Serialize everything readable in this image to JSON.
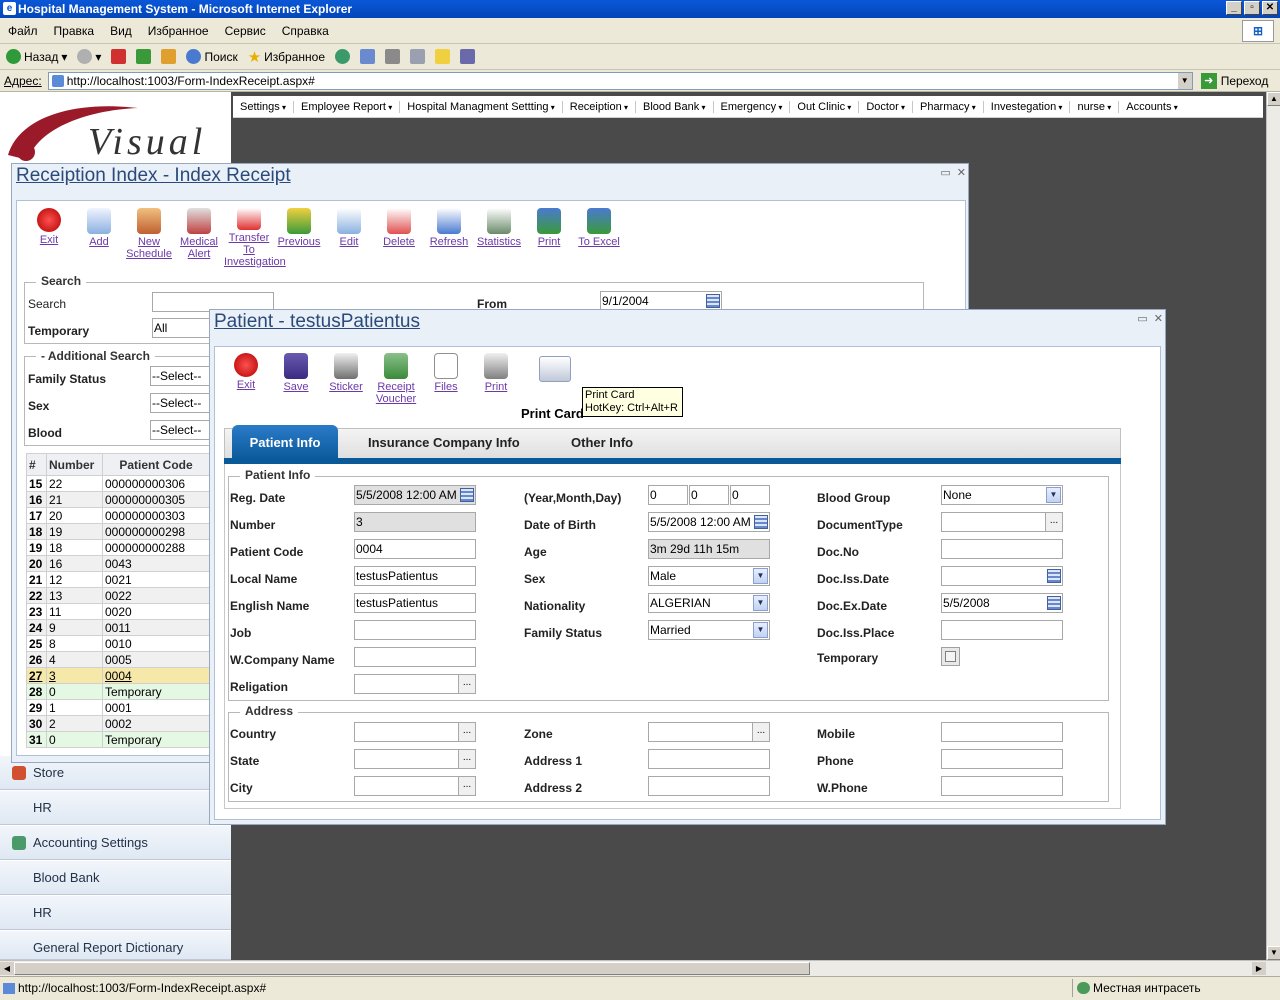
{
  "window": {
    "title": "Hospital Management System - Microsoft Internet Explorer"
  },
  "menu": [
    "Файл",
    "Правка",
    "Вид",
    "Избранное",
    "Сервис",
    "Справка"
  ],
  "toolbar": {
    "back": "Назад",
    "search": "Поиск",
    "favorites": "Избранное"
  },
  "address": {
    "label": "Адрес:",
    "url": "http://localhost:1003/Form-IndexReceipt.aspx#",
    "go": "Переход"
  },
  "status": {
    "url": "http://localhost:1003/Form-IndexReceipt.aspx#",
    "zone": "Местная интрасеть"
  },
  "logo_text": "Visual",
  "nav": [
    "Settings",
    "Employee Report",
    "Hospital Managment Settting",
    "Receiption",
    "Blood Bank",
    "Emergency",
    "Out Clinic",
    "Doctor",
    "Pharmacy",
    "Investegation",
    "nurse",
    "Accounts"
  ],
  "left_nav": [
    "Store",
    "HR",
    "Accounting Settings",
    "Blood Bank",
    "HR",
    "General Report Dictionary"
  ],
  "receipt_window": {
    "title": "Receiption Index - Index Receipt",
    "buttons": [
      "Exit",
      "Add",
      "New Schedule",
      "Medical Alert",
      "Transfer To Investigation",
      "Previous",
      "Edit",
      "Delete",
      "Refresh",
      "Statistics",
      "Print",
      "To Excel"
    ],
    "search_legend": "Search",
    "search_label": "Search",
    "temporary_label": "Temporary",
    "temporary_value": "All",
    "from_label": "From",
    "from_value": "9/1/2004",
    "additional_legend": "- Additional Search",
    "family_status_label": "Family Status",
    "sex_label": "Sex",
    "blood_label": "Blood",
    "select_placeholder": "--Select--",
    "grid_headers": [
      "#",
      "Number",
      "Patient Code"
    ],
    "rows": [
      [
        "15",
        "22",
        "000000000306"
      ],
      [
        "16",
        "21",
        "000000000305"
      ],
      [
        "17",
        "20",
        "000000000303"
      ],
      [
        "18",
        "19",
        "000000000298"
      ],
      [
        "19",
        "18",
        "000000000288"
      ],
      [
        "20",
        "16",
        "0043"
      ],
      [
        "21",
        "12",
        "0021"
      ],
      [
        "22",
        "13",
        "0022"
      ],
      [
        "23",
        "11",
        "0020"
      ],
      [
        "24",
        "9",
        "0011"
      ],
      [
        "25",
        "8",
        "0010"
      ],
      [
        "26",
        "4",
        "0005"
      ],
      [
        "27",
        "3",
        "0004"
      ],
      [
        "28",
        "0",
        "Temporary"
      ],
      [
        "29",
        "1",
        "0001"
      ],
      [
        "30",
        "2",
        "0002"
      ],
      [
        "31",
        "0",
        "Temporary"
      ]
    ]
  },
  "patient_window": {
    "title": "Patient - testusPatientus",
    "buttons": [
      "Exit",
      "Save",
      "Sticker",
      "Receipt Voucher",
      "Files",
      "Print"
    ],
    "print_card_label": "Print Card",
    "tooltip_line1": "Print Card",
    "tooltip_line2": "HotKey: Ctrl+Alt+R",
    "tabs": [
      "Patient Info",
      "Insurance Company Info",
      "Other Info"
    ],
    "patient_info_legend": "Patient Info",
    "address_legend": "Address",
    "fields": {
      "reg_date_label": "Reg. Date",
      "reg_date": "5/5/2008 12:00 AM",
      "number_label": "Number",
      "number": "3",
      "patient_code_label": "Patient Code",
      "patient_code": "0004",
      "local_name_label": "Local Name",
      "local_name": "testusPatientus",
      "english_name_label": "English Name",
      "english_name": "testusPatientus",
      "job_label": "Job",
      "wcompany_label": "W.Company Name",
      "religation_label": "Religation",
      "ymd_label": "(Year,Month,Day)",
      "year": "0",
      "month": "0",
      "day": "0",
      "dob_label": "Date of Birth",
      "dob": "5/5/2008 12:00 AM",
      "age_label": "Age",
      "age": "3m 29d 11h 15m",
      "sex_label": "Sex",
      "sex": "Male",
      "nationality_label": "Nationality",
      "nationality": "ALGERIAN",
      "family_status_label": "Family Status",
      "family_status": "Married",
      "blood_group_label": "Blood Group",
      "blood_group": "None",
      "doc_type_label": "DocumentType",
      "doc_no_label": "Doc.No",
      "doc_iss_date_label": "Doc.Iss.Date",
      "doc_ex_date_label": "Doc.Ex.Date",
      "doc_ex_date": "5/5/2008",
      "doc_iss_place_label": "Doc.Iss.Place",
      "temporary_label": "Temporary",
      "country_label": "Country",
      "state_label": "State",
      "city_label": "City",
      "zone_label": "Zone",
      "address1_label": "Address 1",
      "address2_label": "Address 2",
      "mobile_label": "Mobile",
      "phone_label": "Phone",
      "wphone_label": "W.Phone"
    }
  }
}
